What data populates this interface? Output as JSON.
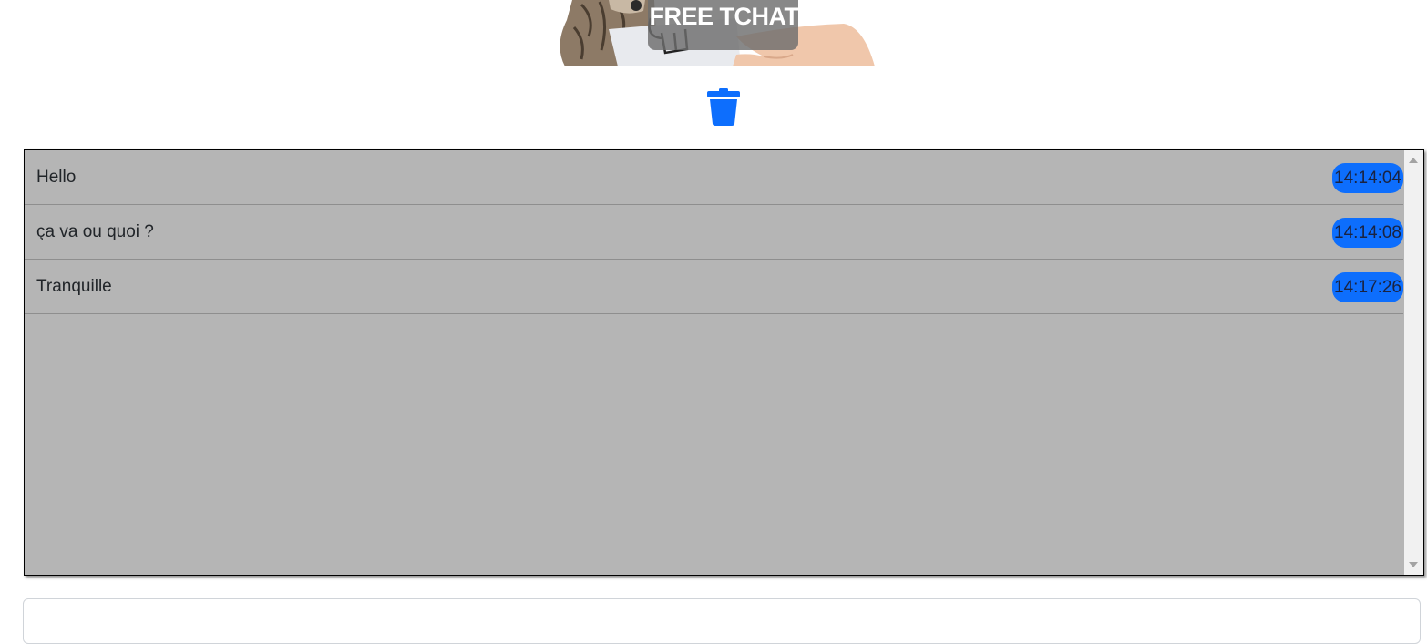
{
  "banner": {
    "title": "FREE TCHAT",
    "image": "cat-holding-card-illustration"
  },
  "toolbar": {
    "delete_icon": "trash-icon",
    "accent_color": "#0d6efd"
  },
  "messages": [
    {
      "text": "Hello",
      "time": "14:14:04"
    },
    {
      "text": "ça va ou quoi ?",
      "time": "14:14:08"
    },
    {
      "text": "Tranquille",
      "time": "14:17:26"
    }
  ],
  "chat_box": {
    "background": "#b5b5b5"
  },
  "input": {
    "value": "",
    "placeholder": ""
  }
}
